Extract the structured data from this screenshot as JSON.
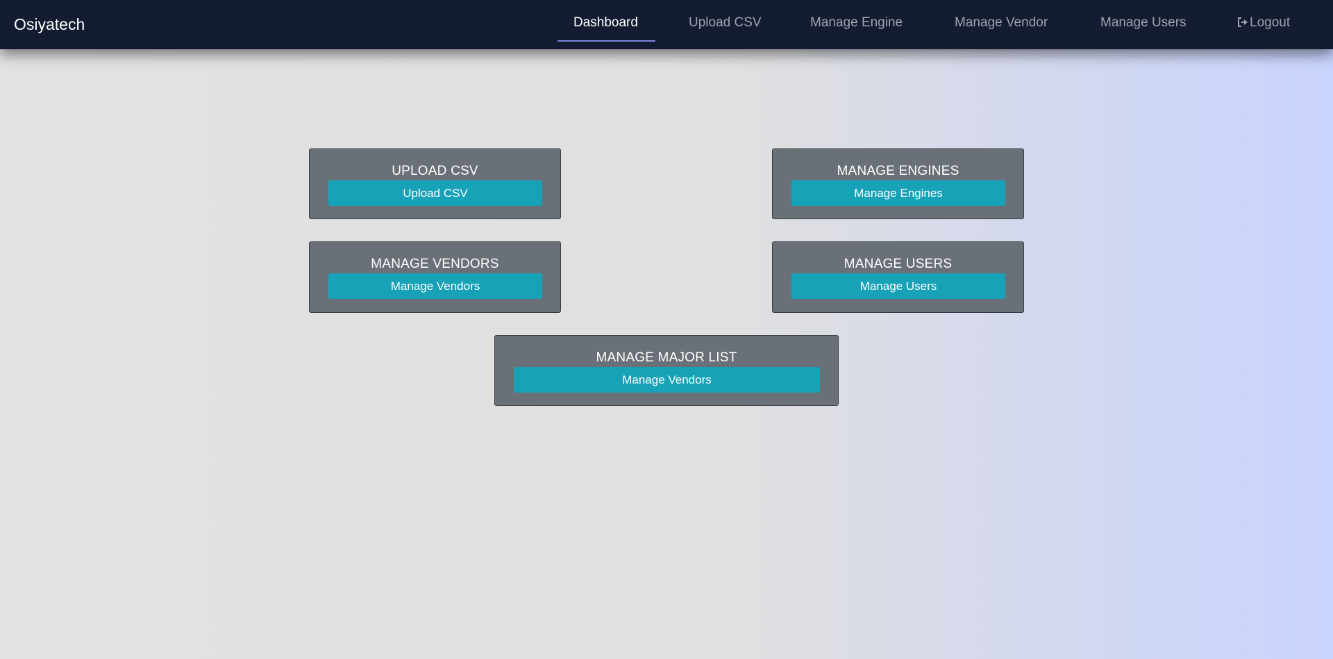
{
  "navbar": {
    "brand": "Osiyatech",
    "links": [
      {
        "label": "Dashboard",
        "active": true
      },
      {
        "label": "Upload CSV"
      },
      {
        "label": "Manage Engine"
      },
      {
        "label": "Manage Vendor"
      },
      {
        "label": "Manage Users"
      },
      {
        "label": "Logout",
        "icon": "logout-icon"
      }
    ]
  },
  "cards": [
    {
      "title": "UPLOAD CSV",
      "button": "Upload CSV"
    },
    {
      "title": "MANAGE ENGINES",
      "button": "Manage Engines"
    },
    {
      "title": "MANAGE VENDORS",
      "button": "Manage Vendors"
    },
    {
      "title": "MANAGE USERS",
      "button": "Manage Users"
    },
    {
      "title": "MANAGE MAJOR LIST",
      "button": "Manage Vendors"
    }
  ],
  "colors": {
    "navbar_bg": "#141c31",
    "card_bg": "#6a7077",
    "button_bg": "#17a2b8",
    "active_underline": "#7c84dd"
  }
}
